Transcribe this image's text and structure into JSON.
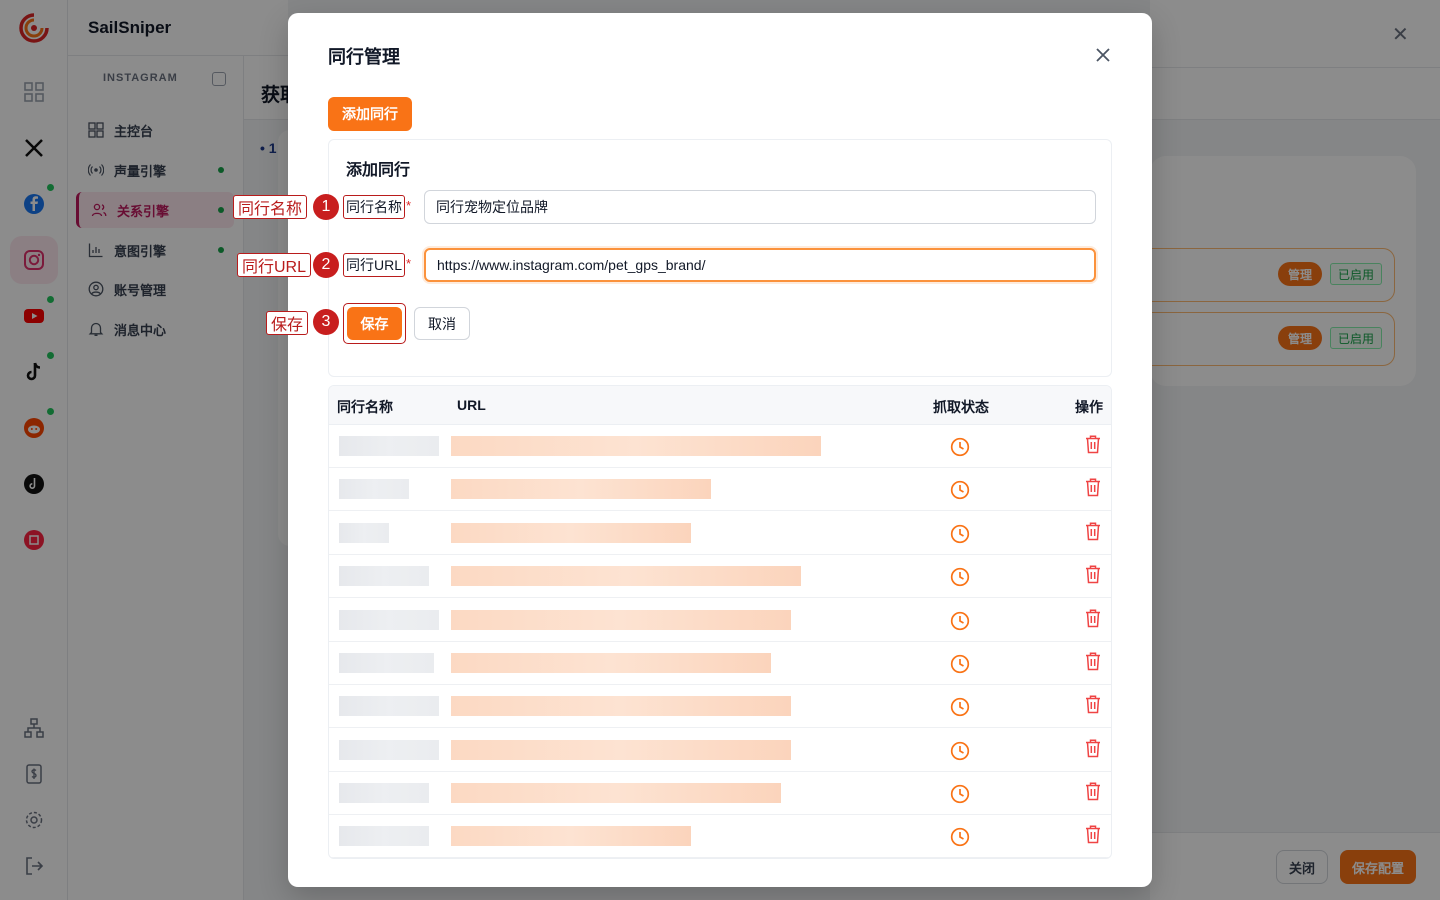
{
  "app": {
    "brand": "SailSniper",
    "rail_icons": [
      "grid-icon",
      "x-twitter-icon",
      "facebook-icon",
      "instagram-icon",
      "youtube-icon",
      "tiktok-icon",
      "reddit-icon",
      "tiktok-alt-icon",
      "xiaohongshu-icon"
    ],
    "rail_bottom_icons": [
      "sitemap-icon",
      "dollar-doc-icon",
      "gear-icon",
      "logout-icon"
    ]
  },
  "sidenav": {
    "section": "INSTAGRAM",
    "items": [
      {
        "label": "主控台",
        "icon": "dashboard-icon"
      },
      {
        "label": "声量引擎",
        "icon": "broadcast-icon"
      },
      {
        "label": "关系引擎",
        "icon": "users-icon"
      },
      {
        "label": "意图引擎",
        "icon": "bar-chart-icon"
      },
      {
        "label": "账号管理",
        "icon": "user-circle-icon"
      },
      {
        "label": "消息中心",
        "icon": "bell-icon"
      }
    ]
  },
  "background": {
    "page_title": "获取",
    "step_text": "• 1",
    "manage_label": "管理",
    "enabled_label": "已启用",
    "close_label": "关闭",
    "save_config_label": "保存配置"
  },
  "modal": {
    "title": "同行管理",
    "add_button": "添加同行",
    "form": {
      "title": "添加同行",
      "name_label": "同行名称",
      "name_value": "同行宠物定位品牌",
      "url_label": "同行URL",
      "url_value": "https://www.instagram.com/pet_gps_brand/",
      "required_mark": "*",
      "save": "保存",
      "cancel": "取消"
    },
    "table": {
      "headers": [
        "同行名称",
        "URL",
        "抓取状态",
        "操作"
      ],
      "rows": [
        {
          "name_blur": 100,
          "url_blur": 370
        },
        {
          "name_blur": 70,
          "url_blur": 260
        },
        {
          "name_blur": 50,
          "url_blur": 240
        },
        {
          "name_blur": 90,
          "url_blur": 350
        },
        {
          "name_blur": 100,
          "url_blur": 340
        },
        {
          "name_blur": 95,
          "url_blur": 320
        },
        {
          "name_blur": 100,
          "url_blur": 340
        },
        {
          "name_blur": 100,
          "url_blur": 340
        },
        {
          "name_blur": 90,
          "url_blur": 330
        },
        {
          "name_blur": 90,
          "url_blur": 240
        }
      ]
    }
  },
  "annotations": [
    {
      "text": "同行名称",
      "num": "1"
    },
    {
      "text": "同行URL",
      "num": "2"
    },
    {
      "text": "保存",
      "num": "3"
    }
  ],
  "colors": {
    "accent": "#f97316",
    "annotation": "#b91c1c",
    "status_ok": "#16a34a"
  }
}
